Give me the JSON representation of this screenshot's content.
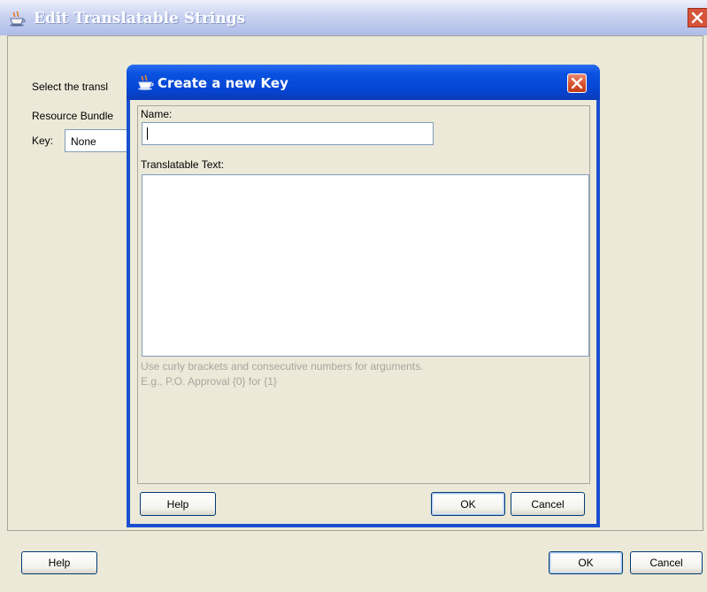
{
  "window": {
    "title": "Edit Translatable Strings",
    "instruction_partial": "Select the transl",
    "resource_bundle_partial": "Resource Bundle",
    "key_label": "Key:",
    "key_value": "None",
    "help_label": "Help",
    "ok_label": "OK",
    "cancel_label": "Cancel"
  },
  "dialog": {
    "title": "Create a new Key",
    "name_label": "Name:",
    "name_value": "",
    "translatable_label": "Translatable Text:",
    "translatable_value": "",
    "hint_line1": "Use curly brackets and consecutive numbers for arguments.",
    "hint_line2": "E.g., P.O. Approval {0} for {1}",
    "help_label": "Help",
    "ok_label": "OK",
    "cancel_label": "Cancel"
  },
  "colors": {
    "dialog_titlebar": "#0a52e0",
    "close_button": "#d8522c",
    "window_face": "#ece9d8"
  },
  "icons": {
    "window_title_icon": "java-cup-icon",
    "dialog_title_icon": "java-cup-icon",
    "close_icon": "close-x-icon"
  }
}
